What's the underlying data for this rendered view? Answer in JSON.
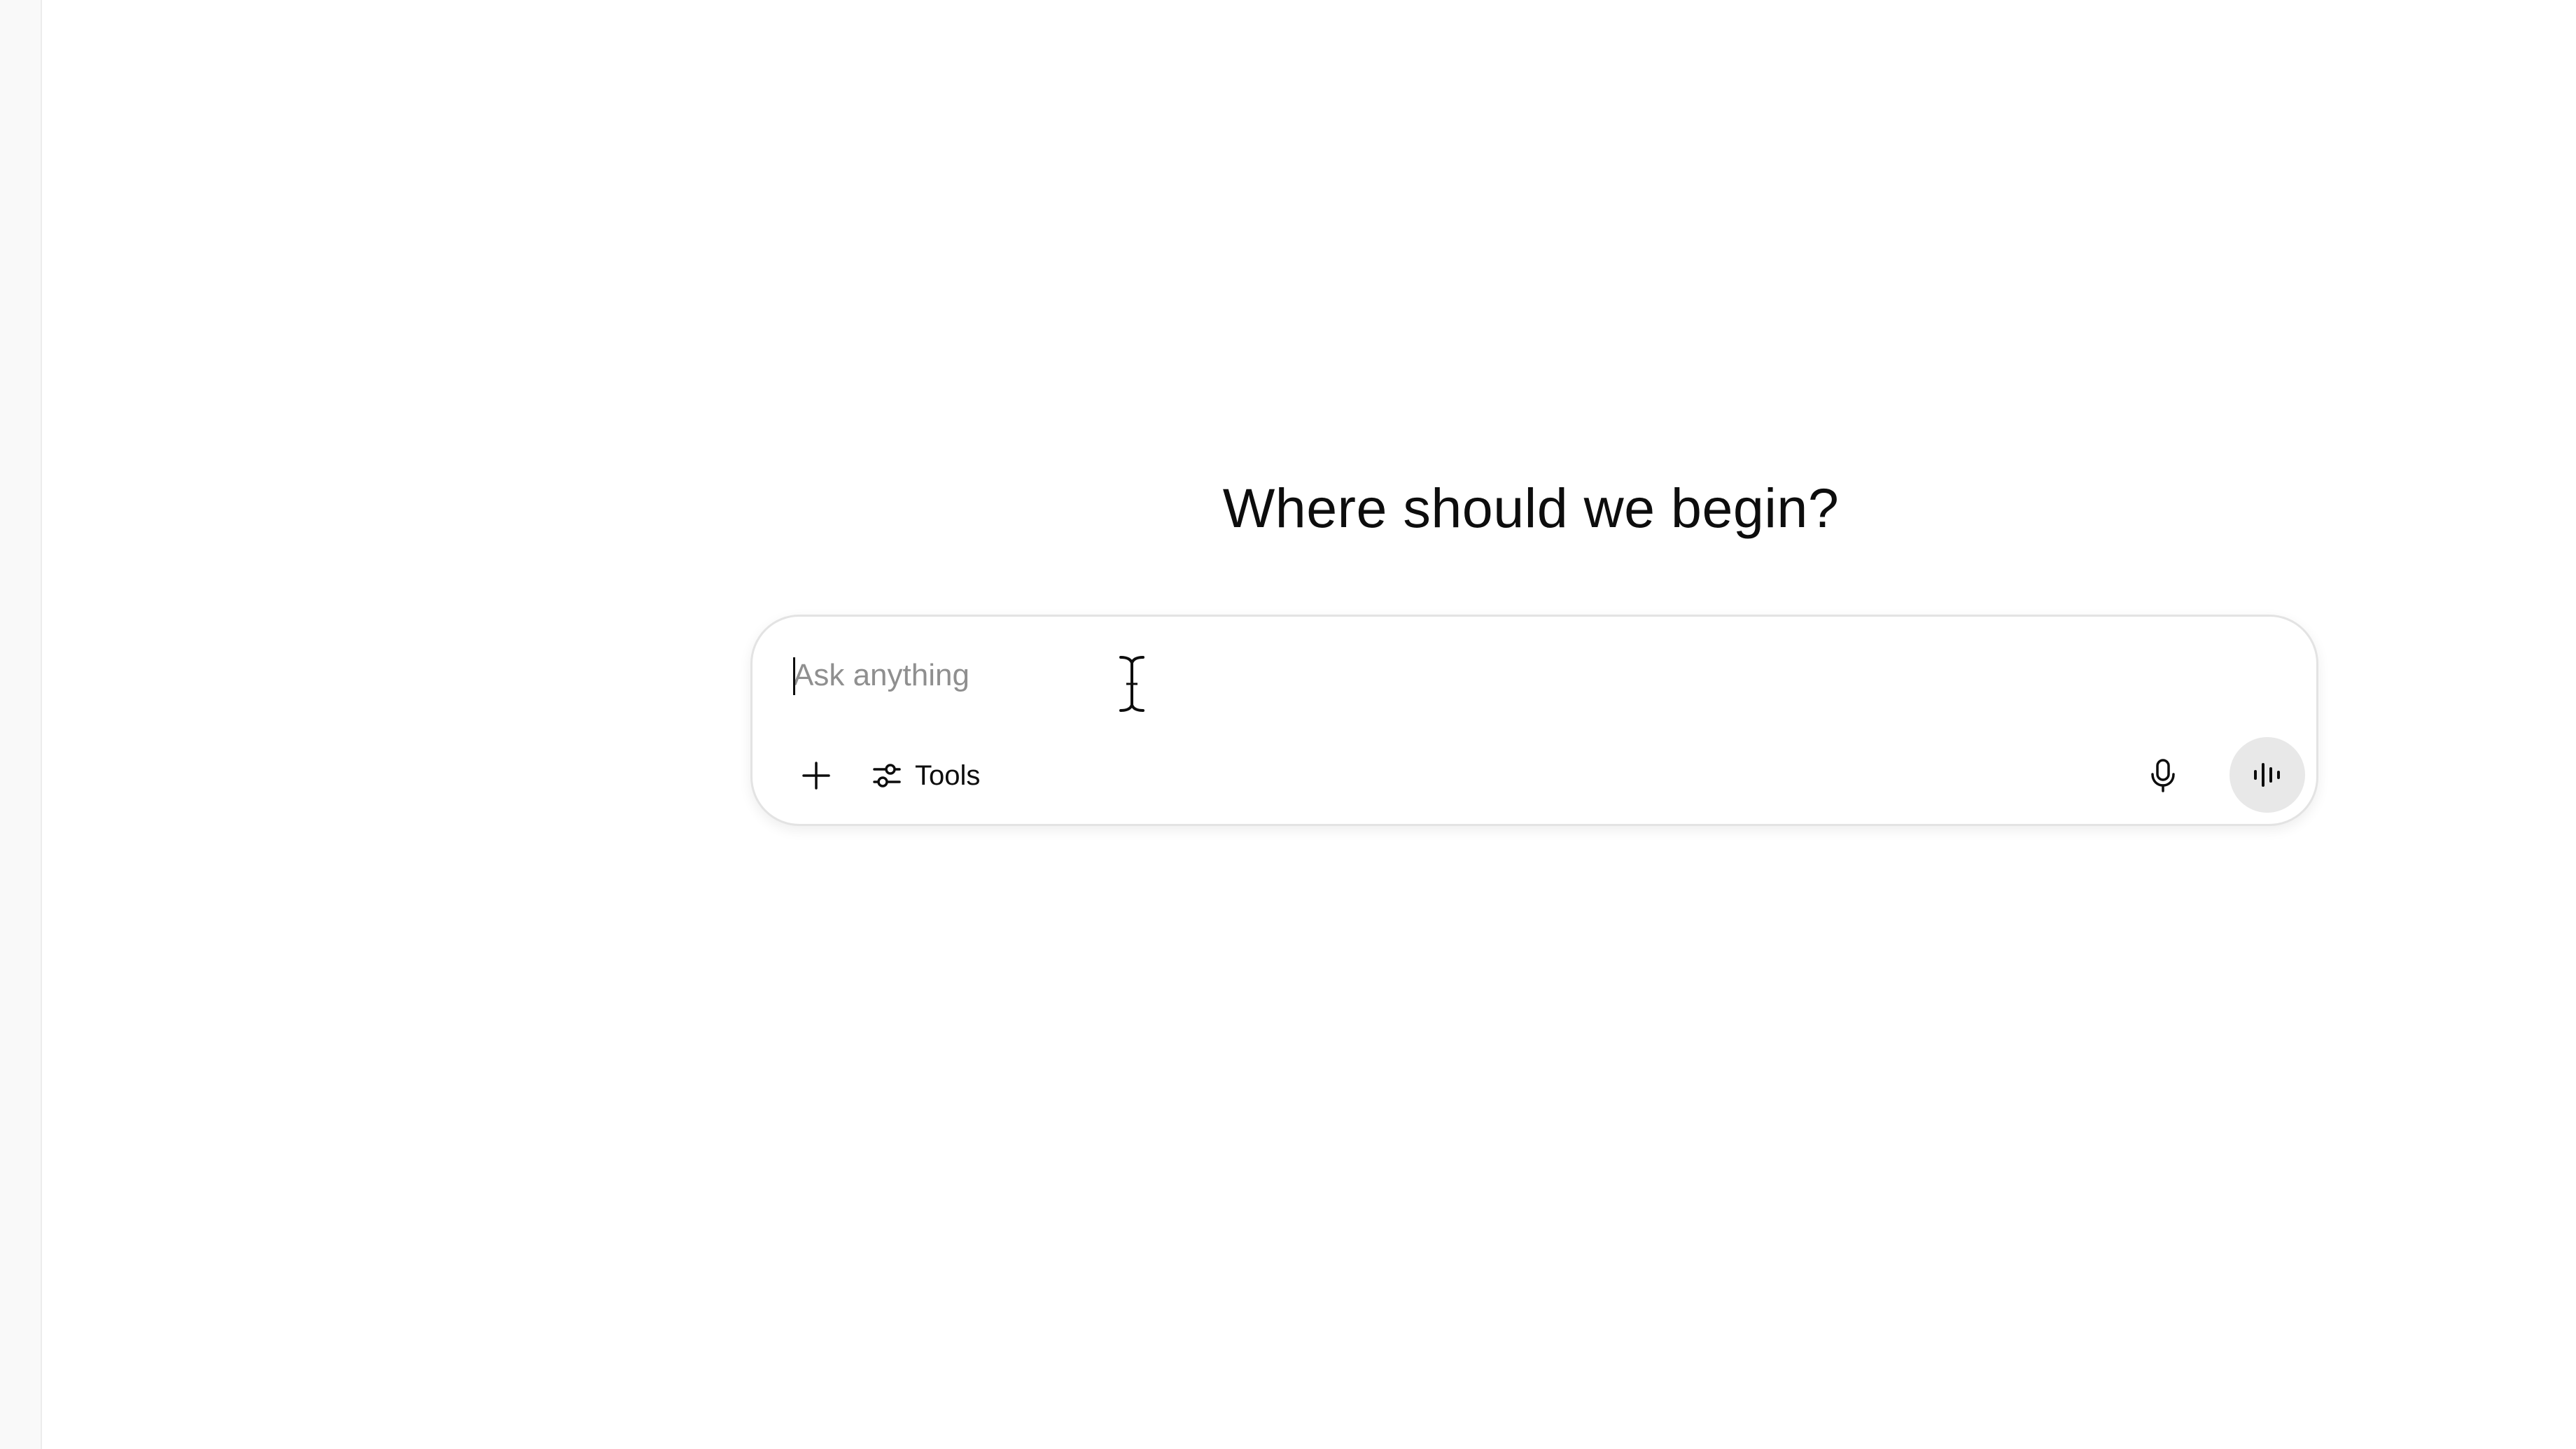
{
  "heading": "Where should we begin?",
  "composer": {
    "placeholder": "Ask anything",
    "value": "",
    "tools_label": "Tools",
    "plus_icon": "plus-icon",
    "tools_icon": "sliders-icon",
    "mic_icon": "microphone-icon",
    "voice_icon": "voice-waveform-icon"
  },
  "colors": {
    "background": "#ffffff",
    "sidebar": "#f9f9f9",
    "text": "#0d0d0d",
    "placeholder": "#8f8f8f",
    "composer_border": "#e3e3e3",
    "voice_button_bg": "#e8e8e8"
  }
}
